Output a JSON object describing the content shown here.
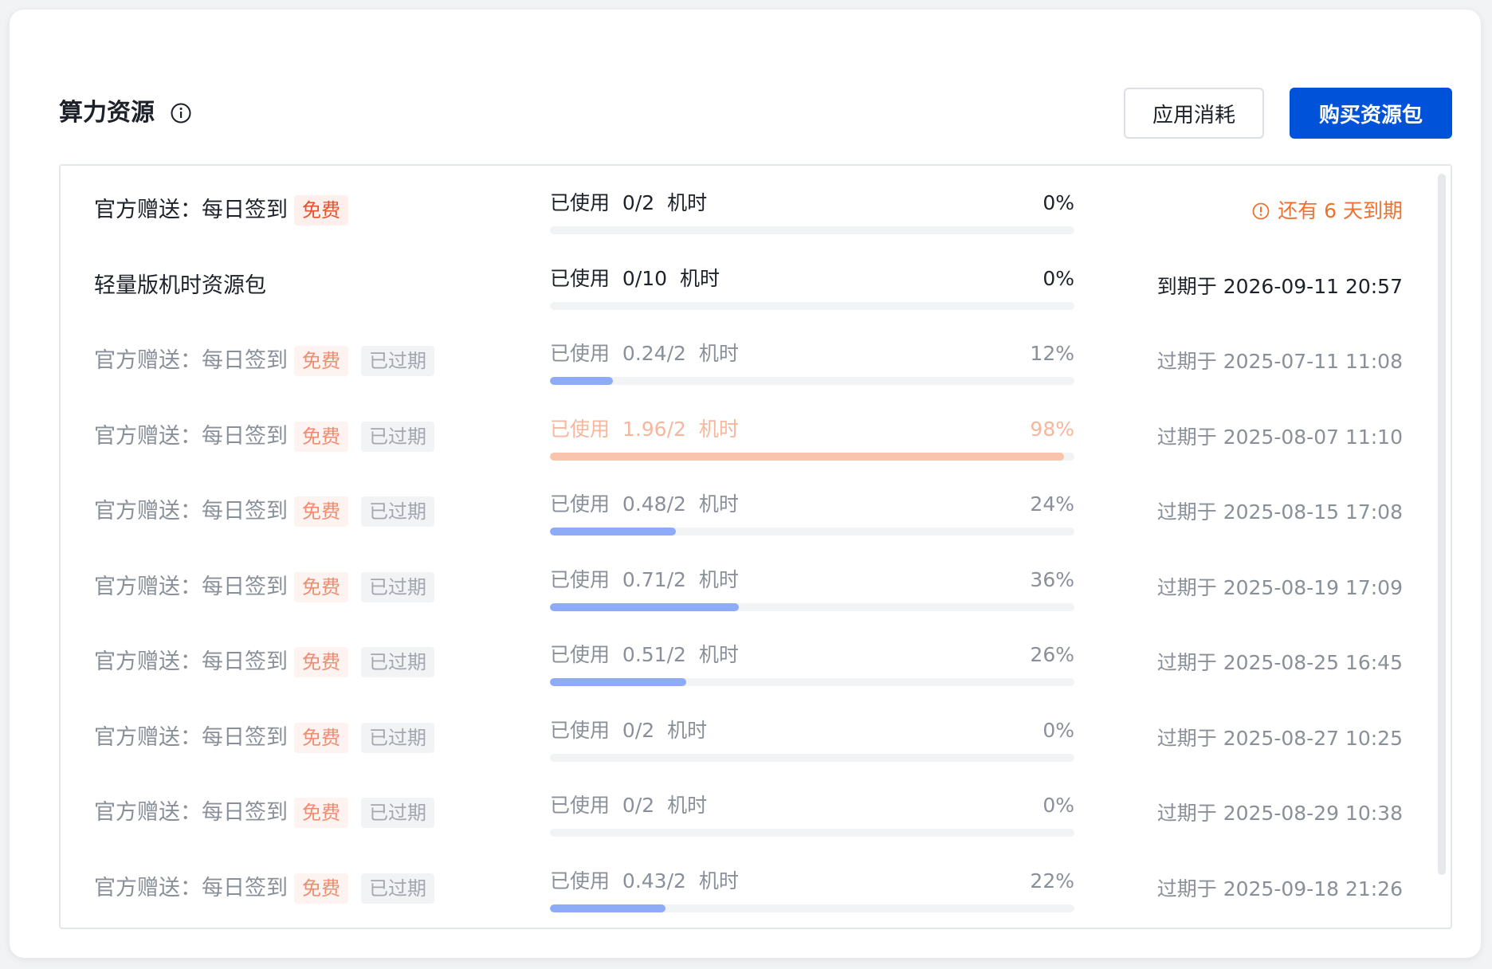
{
  "header": {
    "title": "算力资源",
    "usage_button": "应用消耗",
    "buy_button": "购买资源包"
  },
  "colors": {
    "primary": "#0052d9",
    "bar_normal": "#8eabf7",
    "bar_warning": "#f8c4ad",
    "tag_free": "#e4532f",
    "warning_text": "#f07030"
  },
  "rows": [
    {
      "name": "官方赠送：每日签到",
      "free_tag": "免费",
      "expired_tag": "",
      "used_label": "已使用",
      "usage": "0/2",
      "unit": "机时",
      "percent": "0%",
      "fill": 0,
      "expiry": "还有 6 天到期",
      "state": "active-warn"
    },
    {
      "name": "轻量版机时资源包",
      "free_tag": "",
      "expired_tag": "",
      "used_label": "已使用",
      "usage": "0/10",
      "unit": "机时",
      "percent": "0%",
      "fill": 0,
      "expiry": "到期于 2026-09-11 20:57",
      "state": "active"
    },
    {
      "name": "官方赠送：每日签到",
      "free_tag": "免费",
      "expired_tag": "已过期",
      "used_label": "已使用",
      "usage": "0.24/2",
      "unit": "机时",
      "percent": "12%",
      "fill": 12,
      "expiry": "过期于 2025-07-11 11:08",
      "state": "expired"
    },
    {
      "name": "官方赠送：每日签到",
      "free_tag": "免费",
      "expired_tag": "已过期",
      "used_label": "已使用",
      "usage": "1.96/2",
      "unit": "机时",
      "percent": "98%",
      "fill": 98,
      "expiry": "过期于 2025-08-07 11:10",
      "state": "expired-warm"
    },
    {
      "name": "官方赠送：每日签到",
      "free_tag": "免费",
      "expired_tag": "已过期",
      "used_label": "已使用",
      "usage": "0.48/2",
      "unit": "机时",
      "percent": "24%",
      "fill": 24,
      "expiry": "过期于 2025-08-15 17:08",
      "state": "expired"
    },
    {
      "name": "官方赠送：每日签到",
      "free_tag": "免费",
      "expired_tag": "已过期",
      "used_label": "已使用",
      "usage": "0.71/2",
      "unit": "机时",
      "percent": "36%",
      "fill": 36,
      "expiry": "过期于 2025-08-19 17:09",
      "state": "expired"
    },
    {
      "name": "官方赠送：每日签到",
      "free_tag": "免费",
      "expired_tag": "已过期",
      "used_label": "已使用",
      "usage": "0.51/2",
      "unit": "机时",
      "percent": "26%",
      "fill": 26,
      "expiry": "过期于 2025-08-25 16:45",
      "state": "expired"
    },
    {
      "name": "官方赠送：每日签到",
      "free_tag": "免费",
      "expired_tag": "已过期",
      "used_label": "已使用",
      "usage": "0/2",
      "unit": "机时",
      "percent": "0%",
      "fill": 0,
      "expiry": "过期于 2025-08-27 10:25",
      "state": "expired"
    },
    {
      "name": "官方赠送：每日签到",
      "free_tag": "免费",
      "expired_tag": "已过期",
      "used_label": "已使用",
      "usage": "0/2",
      "unit": "机时",
      "percent": "0%",
      "fill": 0,
      "expiry": "过期于 2025-08-29 10:38",
      "state": "expired"
    },
    {
      "name": "官方赠送：每日签到",
      "free_tag": "免费",
      "expired_tag": "已过期",
      "used_label": "已使用",
      "usage": "0.43/2",
      "unit": "机时",
      "percent": "22%",
      "fill": 22,
      "expiry": "过期于 2025-09-18 21:26",
      "state": "expired"
    }
  ]
}
